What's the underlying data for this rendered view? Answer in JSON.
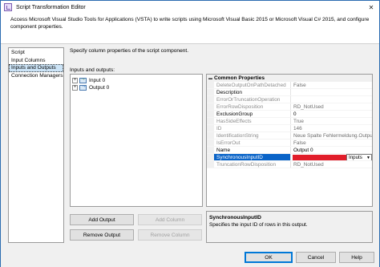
{
  "window": {
    "title": "Script Transformation Editor",
    "controls": [
      "–",
      "□",
      "✕"
    ]
  },
  "description": "Access Microsoft Visual Studio Tools for Applications (VSTA) to write scripts using Microsoft Visual Basic 2015 or Microsoft Visual C# 2015, and configure component properties.",
  "nav": {
    "items": [
      {
        "label": "Script"
      },
      {
        "label": "Input Columns"
      },
      {
        "label": "Inputs and Outputs",
        "selected": true
      },
      {
        "label": "Connection Managers"
      }
    ]
  },
  "main": {
    "hint": "Specify column properties of the script component.",
    "io_label": "Inputs and outputs:",
    "tree": [
      {
        "label": "Input 0",
        "type": "input"
      },
      {
        "label": "Output 0",
        "type": "output"
      }
    ]
  },
  "properties": {
    "category": "Common Properties",
    "rows": [
      {
        "name": "DeleteOutputOnPathDetached",
        "value": "False",
        "readonly": true
      },
      {
        "name": "Description",
        "value": "",
        "readonly": false
      },
      {
        "name": "ErrorOrTruncationOperation",
        "value": "",
        "readonly": true
      },
      {
        "name": "ErrorRowDisposition",
        "value": "RD_NotUsed",
        "readonly": true
      },
      {
        "name": "ExclusionGroup",
        "value": "0",
        "readonly": false
      },
      {
        "name": "HasSideEffects",
        "value": "True",
        "readonly": true
      },
      {
        "name": "ID",
        "value": "146",
        "readonly": true
      },
      {
        "name": "IdentificationString",
        "value": "Neue Spalte Fehlermeldung.Outputs[",
        "readonly": true
      },
      {
        "name": "IsErrorOut",
        "value": "False",
        "readonly": true
      },
      {
        "name": "Name",
        "value": "Output 0",
        "readonly": false
      },
      {
        "name": "SynchronousInputID",
        "value": "",
        "readonly": false,
        "selected": true,
        "dropdown": "Inputs"
      },
      {
        "name": "TruncationRowDisposition",
        "value": "RD_NotUsed",
        "readonly": true
      }
    ],
    "help_title": "SynchronousInputID",
    "help_text": "Specifies the input ID of rows in this output."
  },
  "buttons": {
    "add_output": "Add Output",
    "add_column": "Add Column",
    "remove_output": "Remove Output",
    "remove_column": "Remove Column",
    "ok": "OK",
    "cancel": "Cancel",
    "help": "Help"
  },
  "colors": {
    "selection": "#0a64c8",
    "redaction": "#e11d2a",
    "nav_selected": "#cce4f7"
  }
}
